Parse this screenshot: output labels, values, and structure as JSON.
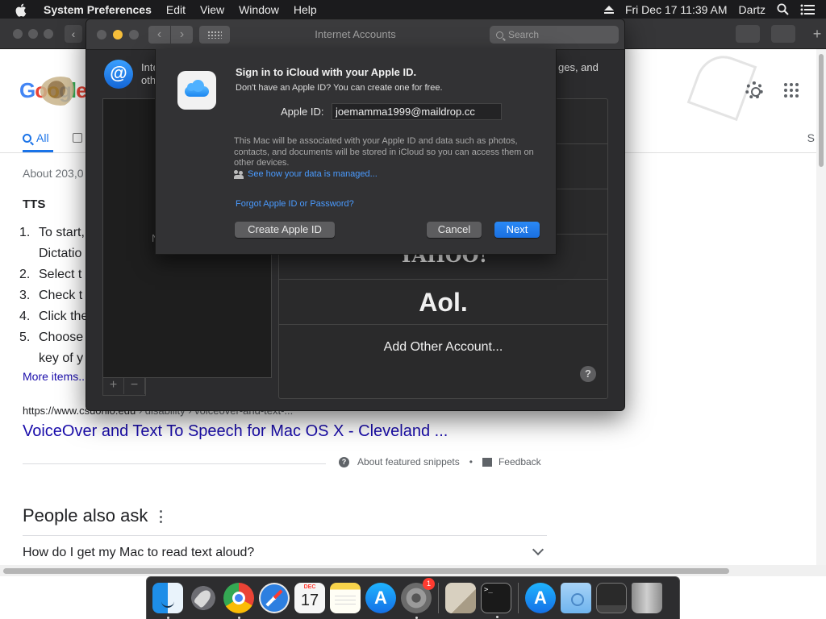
{
  "menubar": {
    "app_name": "System Preferences",
    "menus": [
      "Edit",
      "View",
      "Window",
      "Help"
    ],
    "clock": "Fri Dec 17  11:39 AM",
    "user": "Dartz"
  },
  "browser": {
    "google_logo": "Google",
    "tab_all": "All",
    "tab_s": "S",
    "about": "About 203,0",
    "tts_heading": "TTS",
    "list": [
      {
        "num": "1.",
        "text": "To start,",
        "text2": "Dictatio"
      },
      {
        "num": "2.",
        "text": "Select t"
      },
      {
        "num": "3.",
        "text": "Check t"
      },
      {
        "num": "4.",
        "text": "Click the"
      },
      {
        "num": "5.",
        "text": "Choose",
        "text2": "key of y"
      }
    ],
    "more_items": "More items...",
    "result_url": "https://www.csuohio.edu",
    "result_breadcrumb": " › disability › voiceover-and-text-...",
    "result_title": "VoiceOver and Text To Speech for Mac OS X - Cleveland ...",
    "about_snippets": "About featured snippets",
    "feedback": "Feedback",
    "people_also_ask": "People also ask",
    "question_1": "How do I get my Mac to read text aloud?"
  },
  "sysprefs": {
    "title": "Internet Accounts",
    "search_placeholder": "Search",
    "desc_left_1": "Inte",
    "desc_left_2": "oth",
    "desc_right": "ges, and",
    "left_panel_letter": "N",
    "accounts": [
      "YAHOO!",
      "Aol.",
      "Add Other Account..."
    ],
    "help": "?"
  },
  "sheet": {
    "title": "Sign in to iCloud with your Apple ID.",
    "subtitle": "Don't have an Apple ID? You can create one for free.",
    "apple_id_label": "Apple ID:",
    "apple_id_value": "joemamma1999@maildrop.cc",
    "info": "This Mac will be associated with your Apple ID and data such as photos, contacts, and documents will be stored in iCloud so you can access them on other devices.",
    "data_link": "See how your data is managed...",
    "forgot": "Forgot Apple ID or Password?",
    "create_btn": "Create Apple ID",
    "cancel_btn": "Cancel",
    "next_btn": "Next"
  },
  "dock": {
    "calendar_month": "DEC",
    "calendar_day": "17",
    "sysprefs_badge": "1",
    "terminal_prompt": ">_"
  },
  "colors": {
    "accent_blue": "#1a6fe0",
    "link_blue": "#4a9bff",
    "google_link": "#1a0dab"
  }
}
